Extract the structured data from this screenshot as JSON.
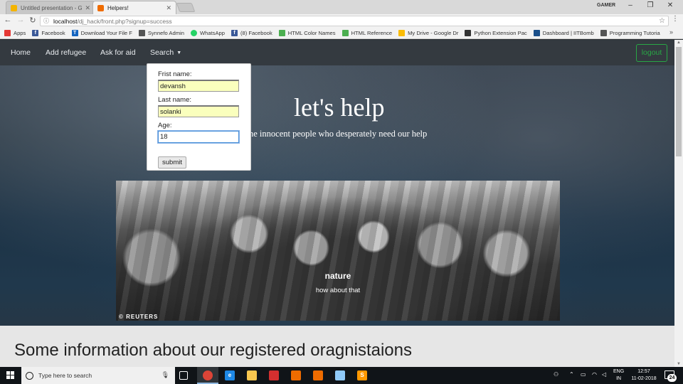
{
  "browser": {
    "tabs": [
      {
        "title": "Untitled presentation - G",
        "favicon_color": "#f4b400",
        "active": false
      },
      {
        "title": "Helpers!",
        "favicon_color": "#ef6c00",
        "active": true
      }
    ],
    "window_user": "GAMER",
    "url_host": "localhost",
    "url_path": "/dj_hack/front.php?signup=success",
    "bookmarks": [
      {
        "label": "Apps",
        "icon": "apps-grid-icon",
        "color": "#e53935"
      },
      {
        "label": "Facebook",
        "icon": "facebook-icon",
        "color": "#3b5998"
      },
      {
        "label": "Download Your File F",
        "icon": "t-icon",
        "color": "#1565c0"
      },
      {
        "label": "Synnefo Admin",
        "icon": "synnefo-icon",
        "color": "#555555"
      },
      {
        "label": "WhatsApp",
        "icon": "whatsapp-icon",
        "color": "#25d366"
      },
      {
        "label": "(8) Facebook",
        "icon": "facebook-icon",
        "color": "#3b5998"
      },
      {
        "label": "HTML Color Names",
        "icon": "w3-icon",
        "color": "#4caf50"
      },
      {
        "label": "HTML Reference",
        "icon": "w3-icon",
        "color": "#4caf50"
      },
      {
        "label": "My Drive - Google Dr",
        "icon": "drive-icon",
        "color": "#fbbc04"
      },
      {
        "label": "Python Extension Pac",
        "icon": "lfd-icon",
        "color": "#333333"
      },
      {
        "label": "Dashboard | IITBomb",
        "icon": "dashboard-icon",
        "color": "#1a4f8a"
      },
      {
        "label": "Programming Tutoria",
        "icon": "page-icon",
        "color": "#555555"
      }
    ]
  },
  "site": {
    "nav": {
      "home": "Home",
      "add_refugee": "Add refugee",
      "ask_for_aid": "Ask for aid",
      "search": "Search",
      "logout": "logout"
    },
    "form": {
      "first_name_label": "Frist name:",
      "first_name_value": "devansh",
      "last_name_label": "Last name:",
      "last_name_value": "solanki",
      "age_label": "Age:",
      "age_value": "18",
      "submit": "submit"
    },
    "hero": {
      "title": "let's help",
      "subtitle": "he innocent people who desperately need our help"
    },
    "carousel": {
      "caption_title": "nature",
      "caption_text": "how about that",
      "watermark": "© REUTERS"
    },
    "info_heading": "Some information about our registered oragnistaions"
  },
  "taskbar": {
    "search_placeholder": "Type here to search",
    "language_top": "ENG",
    "language_bottom": "IN",
    "time": "12:57",
    "date": "11-02-2018",
    "notification_count": "24"
  }
}
